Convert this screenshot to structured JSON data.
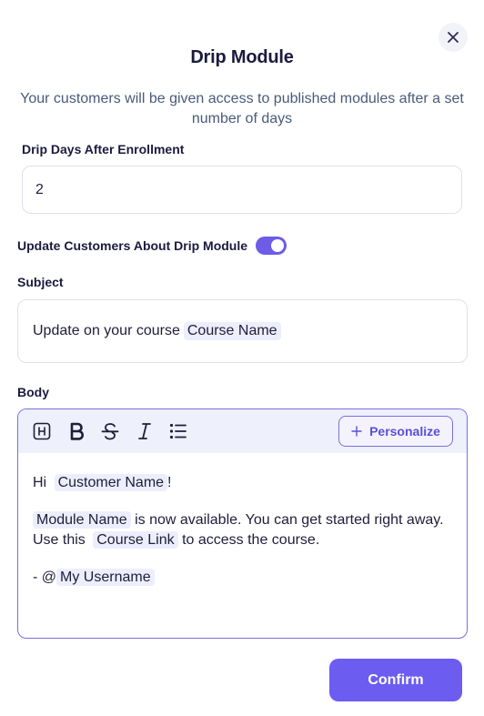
{
  "dialog": {
    "title": "Drip Module",
    "subtitle": "Your customers will be given access to published modules after a set number of days"
  },
  "drip_days": {
    "label": "Drip Days After Enrollment",
    "value": "2"
  },
  "update_toggle": {
    "label": "Update Customers About Drip Module",
    "on": true
  },
  "subject": {
    "label": "Subject",
    "text": "Update on your course",
    "chip": "Course Name"
  },
  "body": {
    "label": "Body",
    "personalize_label": "Personalize",
    "toolbar": [
      "heading-icon",
      "bold-icon",
      "strikethrough-icon",
      "italic-icon",
      "bullet-list-icon"
    ],
    "line1_prefix": "Hi",
    "line1_chip": "Customer Name",
    "line1_suffix": "!",
    "line2_chip": "Module Name",
    "line2_text": "is now available. You can get started right away. Use this",
    "line2_chip2": "Course Link",
    "line2_suffix": "to access the course.",
    "line3_prefix": "- @",
    "line3_chip": "My Username"
  },
  "footer": {
    "confirm_label": "Confirm"
  },
  "colors": {
    "accent": "#6c5cf0",
    "chip_bg": "#eceefc",
    "toolbar_bg": "#eef0fb"
  }
}
